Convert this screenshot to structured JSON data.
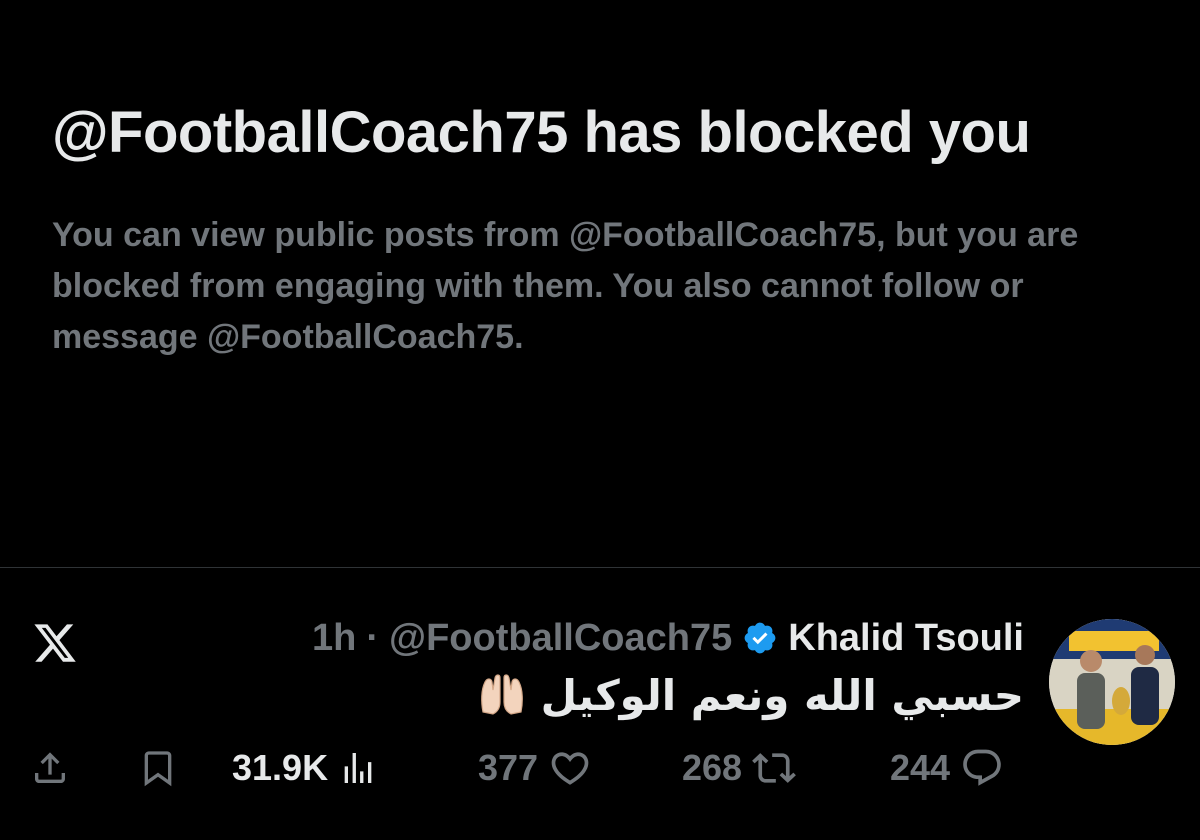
{
  "blocked": {
    "title": "@FootballCoach75 has blocked you",
    "description": "You can view public posts from @FootballCoach75, but you are blocked from engaging with them. You also cannot follow or message @FootballCoach75."
  },
  "tweet": {
    "author_name": "Khalid Tsouli",
    "verified": true,
    "handle": "@FootballCoach75",
    "time": "1h",
    "meta_separator": "·",
    "text": "حسبي الله ونعم الوكيل",
    "emoji": "raised-palms-emoji",
    "brand_icon": "x-logo-icon"
  },
  "actions": {
    "views": "31.9K",
    "likes": "377",
    "retweets": "268",
    "replies": "244"
  },
  "colors": {
    "background": "#000000",
    "primary_text": "#e7e9ea",
    "secondary_text": "#71767b",
    "verified_blue": "#1d9bf0",
    "divider": "#2f3336"
  }
}
